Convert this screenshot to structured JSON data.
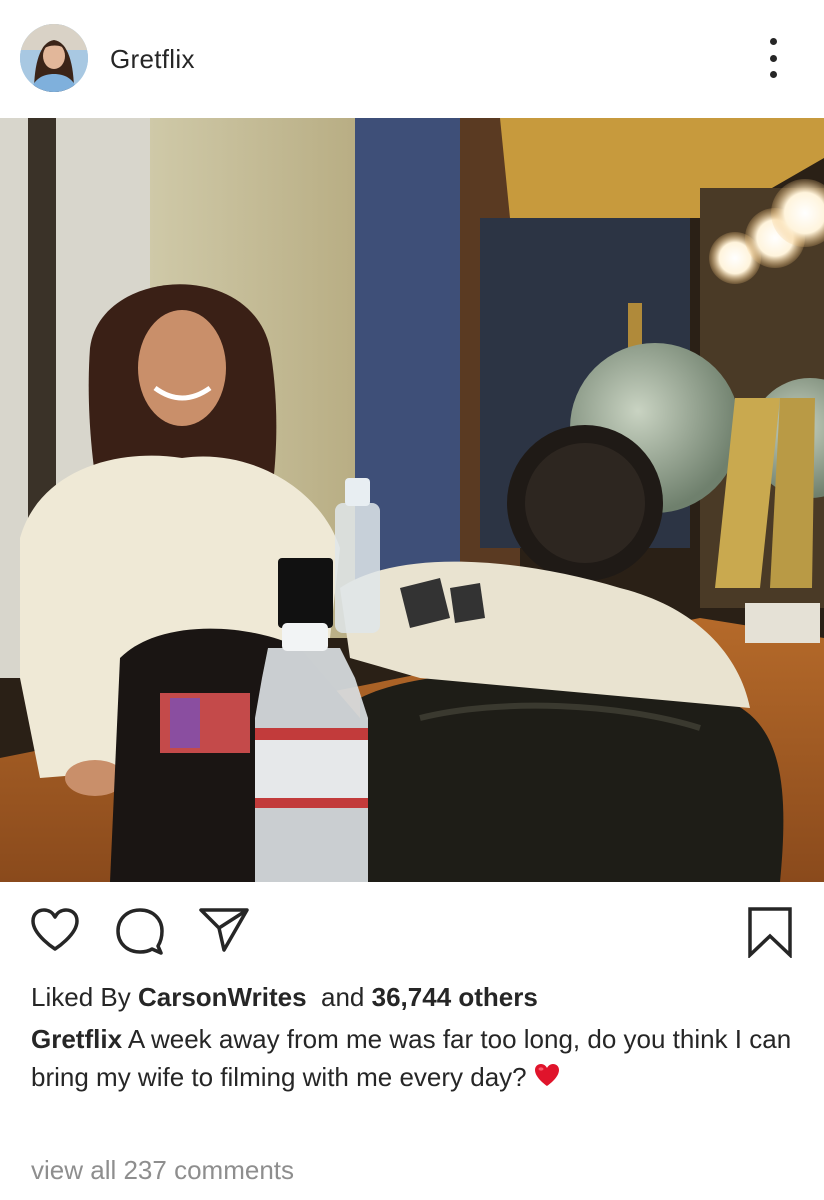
{
  "post": {
    "username": "Gretflix",
    "header_icons": {
      "avatar": "profile-avatar",
      "more": "more-options-icon"
    },
    "photo": {
      "description_icon": "post-photo"
    },
    "actions": {
      "like_icon": "heart-outline-icon",
      "comment_icon": "comment-bubble-icon",
      "share_icon": "paper-plane-icon",
      "save_icon": "bookmark-icon"
    },
    "likes": {
      "prefix": "Liked By",
      "user": "CarsonWrites",
      "middle": "and",
      "others": "36,744 others"
    },
    "caption": {
      "user": "Gretflix",
      "text": "A week away from me was far too long, do you think I can bring my wife to filming with me every day?",
      "emoji": "red-heart-emoji"
    },
    "comments_link": "view all 237 comments",
    "colors": {
      "text": "#262626",
      "muted": "#8e8e8e",
      "heart": "#e0142b"
    }
  }
}
